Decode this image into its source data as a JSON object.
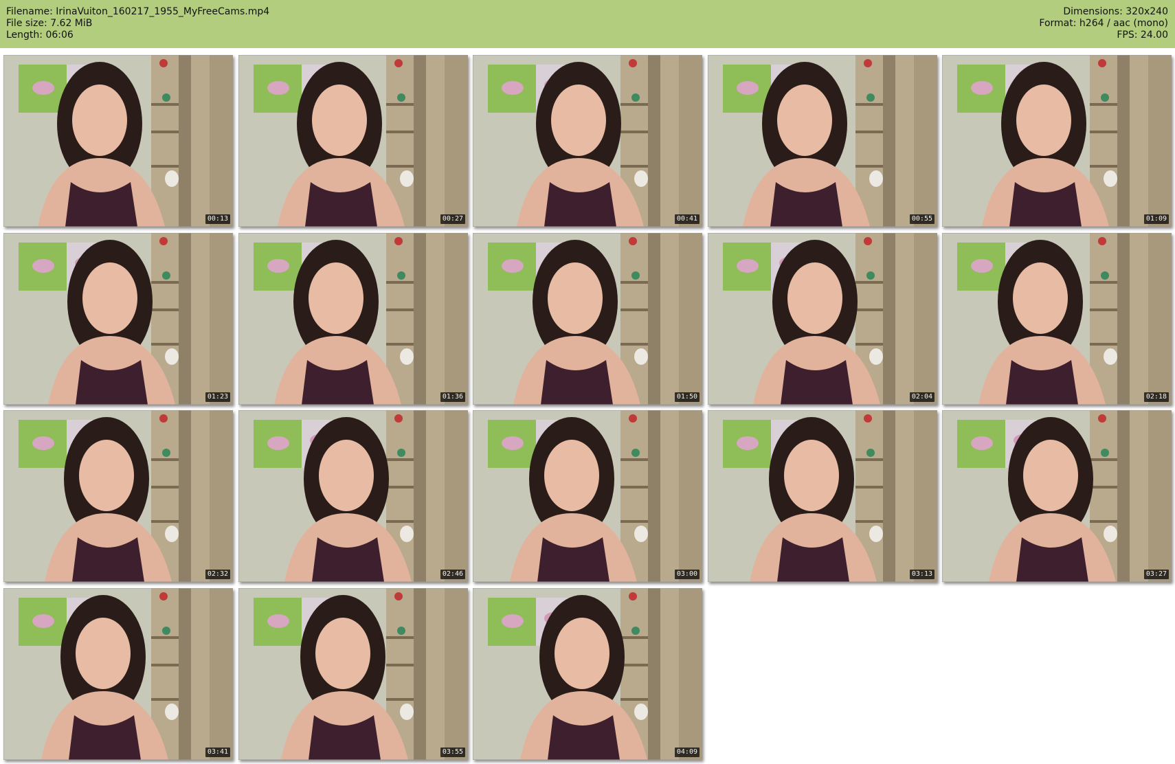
{
  "header": {
    "filename_label": "Filename: IrinaVuiton_160217_1955_MyFreeCams.mp4",
    "filesize_label": "File size: 7.62 MiB",
    "length_label": "Length: 06:06",
    "dimensions_label": "Dimensions: 320x240",
    "format_label": "Format: h264 / aac (mono)",
    "fps_label": "FPS: 24.00",
    "background_color": "#b3cd7e"
  },
  "thumbnails": [
    {
      "timestamp": "00:13"
    },
    {
      "timestamp": "00:27"
    },
    {
      "timestamp": "00:41"
    },
    {
      "timestamp": "00:55"
    },
    {
      "timestamp": "01:09"
    },
    {
      "timestamp": "01:23"
    },
    {
      "timestamp": "01:36"
    },
    {
      "timestamp": "01:50"
    },
    {
      "timestamp": "02:04"
    },
    {
      "timestamp": "02:18"
    },
    {
      "timestamp": "02:32"
    },
    {
      "timestamp": "02:46"
    },
    {
      "timestamp": "03:00"
    },
    {
      "timestamp": "03:13"
    },
    {
      "timestamp": "03:27"
    },
    {
      "timestamp": "03:41"
    },
    {
      "timestamp": "03:55"
    },
    {
      "timestamp": "04:09"
    }
  ]
}
